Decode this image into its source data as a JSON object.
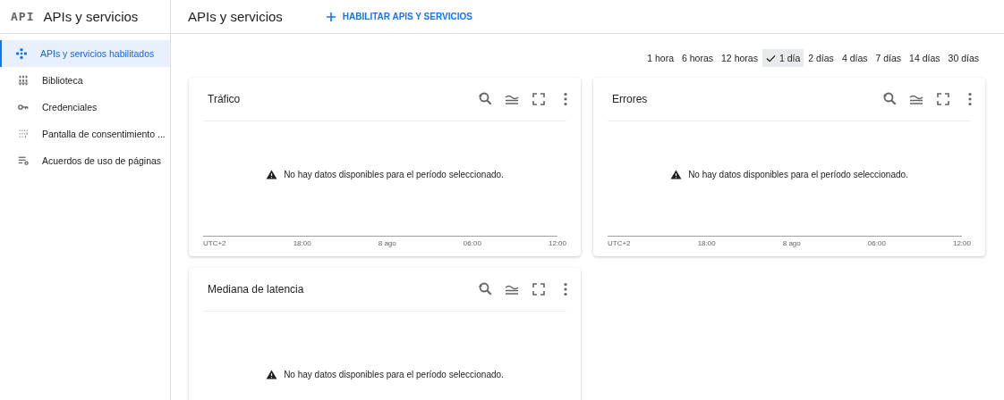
{
  "sidebar": {
    "logo": "API",
    "title": "APIs y servicios",
    "items": [
      {
        "label": "APIs y servicios habilitados",
        "kind": "apis",
        "selected": true
      },
      {
        "label": "Biblioteca",
        "kind": "library",
        "selected": false
      },
      {
        "label": "Credenciales",
        "kind": "key",
        "selected": false
      },
      {
        "label": "Pantalla de consentimiento ...",
        "kind": "consent",
        "selected": false
      },
      {
        "label": "Acuerdos de uso de páginas",
        "kind": "agreements",
        "selected": false
      }
    ]
  },
  "header": {
    "title": "APIs y servicios",
    "action": "HABILITAR APIS Y SERVICIOS"
  },
  "time_ranges": [
    {
      "label": "1 hora",
      "selected": false
    },
    {
      "label": "6 horas",
      "selected": false
    },
    {
      "label": "12 horas",
      "selected": false
    },
    {
      "label": "1 día",
      "selected": true
    },
    {
      "label": "2 días",
      "selected": false
    },
    {
      "label": "4 días",
      "selected": false
    },
    {
      "label": "7 días",
      "selected": false
    },
    {
      "label": "14 días",
      "selected": false
    },
    {
      "label": "30 días",
      "selected": false
    }
  ],
  "cards": [
    {
      "title": "Tráfico",
      "message": "No hay datos disponibles para el período seleccionado.",
      "axis_labels": [
        "UTC+2",
        "18:00",
        "8 ago",
        "06:00",
        "12:00"
      ]
    },
    {
      "title": "Errores",
      "message": "No hay datos disponibles para el período seleccionado.",
      "axis_labels": [
        "UTC+2",
        "18:00",
        "8 ago",
        "06:00",
        "12:00"
      ]
    },
    {
      "title": "Mediana de latencia",
      "message": "No hay datos disponibles para el período seleccionado."
    }
  ]
}
